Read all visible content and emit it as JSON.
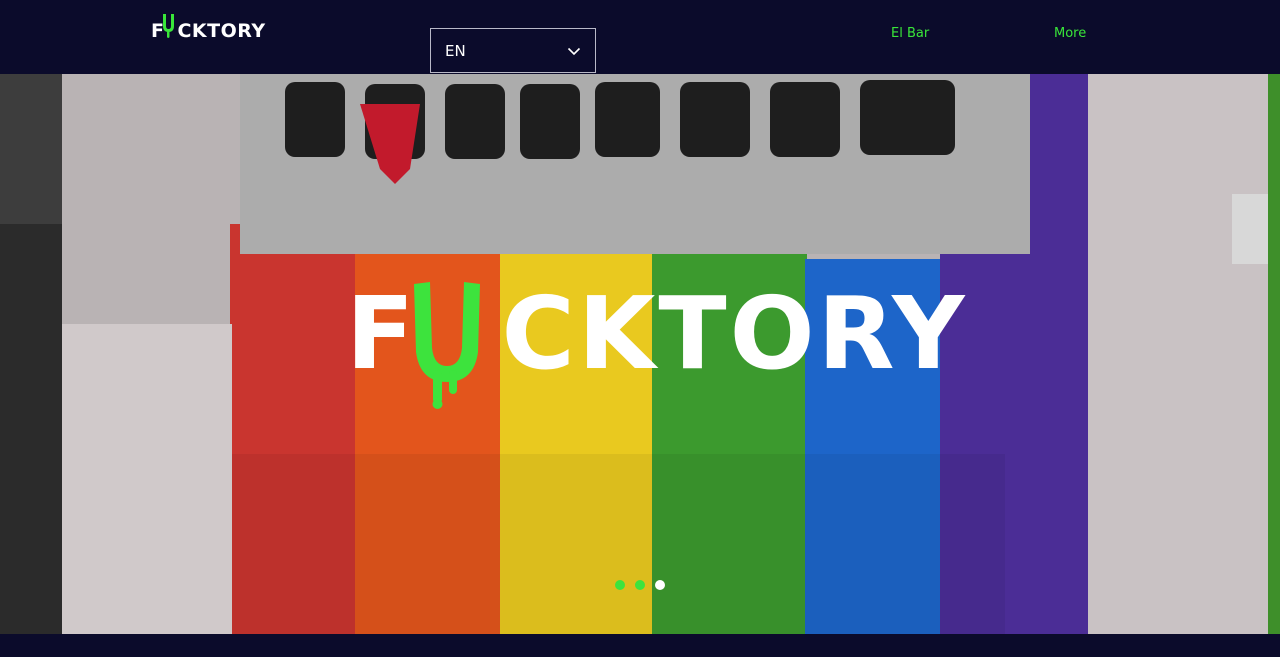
{
  "header": {
    "logo_text_before": "F",
    "logo_text_u": "U",
    "logo_text_after": "CKTORY",
    "language": {
      "selected": "EN"
    },
    "nav": [
      {
        "label": "El Bar"
      },
      {
        "label": "More"
      }
    ]
  },
  "hero": {
    "title_before": "F",
    "title_u": "U",
    "title_after": "CKTORY",
    "slider": {
      "count": 3,
      "active_index": 2
    }
  },
  "colors": {
    "background": "#0b0b2b",
    "accent_green": "#39e639",
    "text_white": "#ffffff"
  },
  "icons": {
    "dropdown": "chevron-down-icon"
  }
}
